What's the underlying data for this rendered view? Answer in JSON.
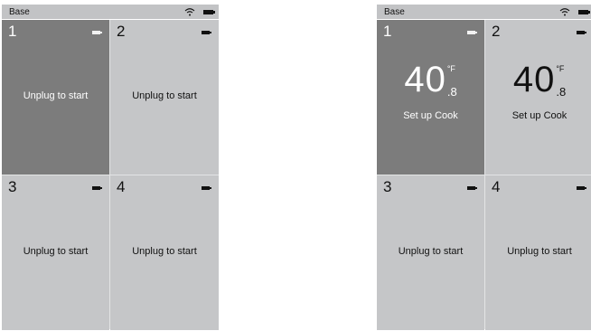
{
  "screens": [
    {
      "status_title": "Base",
      "tiles": [
        {
          "number": "1",
          "message": "Unplug to start"
        },
        {
          "number": "2",
          "message": "Unplug to start"
        },
        {
          "number": "3",
          "message": "Unplug to start"
        },
        {
          "number": "4",
          "message": "Unplug to start"
        }
      ]
    },
    {
      "status_title": "Base",
      "tiles": [
        {
          "number": "1",
          "temp": "40",
          "unit": "°F",
          "decimal": ".8",
          "action": "Set up Cook"
        },
        {
          "number": "2",
          "temp": "40",
          "unit": "°F",
          "decimal": ".8",
          "action": "Set up Cook"
        },
        {
          "number": "3",
          "message": "Unplug to start"
        },
        {
          "number": "4",
          "message": "Unplug to start"
        }
      ]
    }
  ],
  "colors": {
    "status_bar": "#c2c3c5",
    "tile_light": "#c5c6c8",
    "tile_selected": "#7c7c7c"
  },
  "icons": [
    "wifi-icon",
    "battery-icon",
    "probe-battery-icon"
  ]
}
